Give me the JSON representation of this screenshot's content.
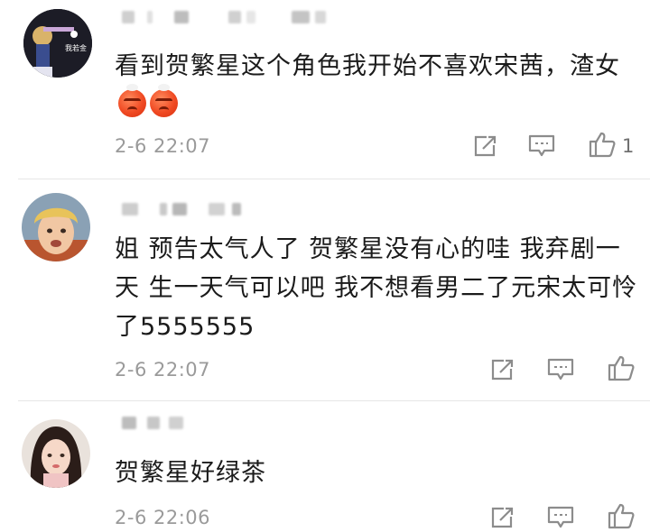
{
  "colors": {
    "text": "#1b1b1b",
    "muted": "#9a9a9a",
    "icon": "#8c8c8c",
    "emoji": "#f04a23"
  },
  "comments": [
    {
      "avatar_label": "我若金",
      "text": "看到贺繁星这个角色我开始不喜欢宋茜，渣女",
      "emojis": [
        "angry-face-emoji",
        "angry-face-emoji"
      ],
      "time": "2-6 22:07",
      "likes": "1"
    },
    {
      "text": "姐 预告太气人了 贺繁星没有心的哇 我弃剧一天 生一天气可以吧 我不想看男二了元宋太可怜了5555555",
      "time": "2-6 22:07",
      "likes": ""
    },
    {
      "text": "贺繁星好绿茶",
      "time": "2-6 22:06",
      "likes": ""
    }
  ]
}
